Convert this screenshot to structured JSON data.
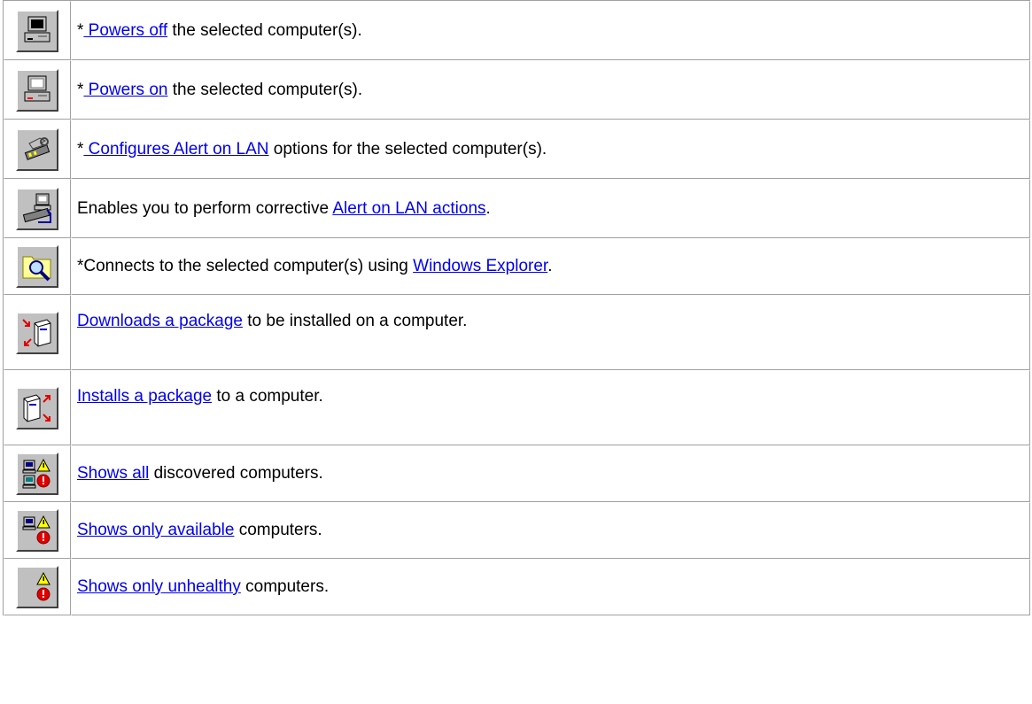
{
  "rows": [
    {
      "prefix": "*",
      "link": " Powers off",
      "suffix": " the selected computer(s).",
      "icon": "computer-off-icon"
    },
    {
      "prefix": "*",
      "link": " Powers on",
      "suffix": " the selected computer(s).",
      "icon": "computer-on-icon"
    },
    {
      "prefix": "*",
      "link": " Configures Alert on LAN",
      "suffix": " options for the selected computer(s).",
      "icon": "wrench-config-icon"
    },
    {
      "prefix": "Enables you to perform corrective ",
      "link": "Alert on LAN actions",
      "suffix": ".",
      "icon": "network-actions-icon"
    },
    {
      "prefix": "*Connects to the selected computer(s) using ",
      "link": "Windows Explorer",
      "suffix": ".",
      "icon": "folder-search-icon"
    },
    {
      "prefix": "",
      "link": "Downloads a package",
      "suffix": " to be installed on a computer.",
      "icon": "download-package-icon"
    },
    {
      "prefix": "",
      "link": "Installs a package",
      "suffix": " to a computer.",
      "icon": "install-package-icon"
    },
    {
      "prefix": "",
      "link": "Shows all",
      "suffix": " discovered computers.",
      "icon": "show-all-icon"
    },
    {
      "prefix": "",
      "link": "Shows only available",
      "suffix": " computers.",
      "icon": "show-available-icon"
    },
    {
      "prefix": "",
      "link": "Shows only unhealthy",
      "suffix": " computers.",
      "icon": "show-unhealthy-icon"
    }
  ]
}
